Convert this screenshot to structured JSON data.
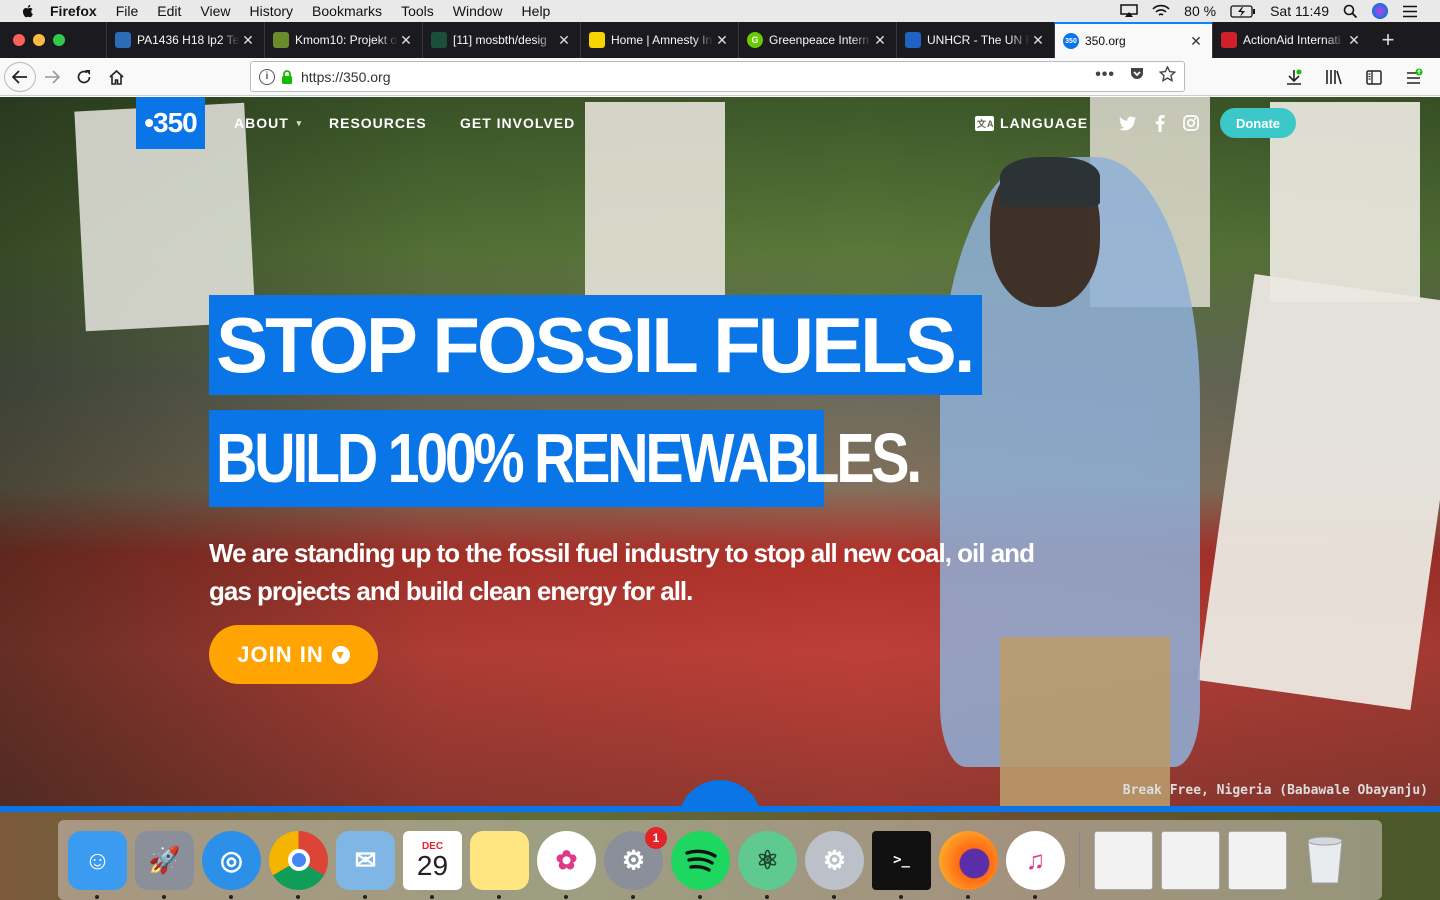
{
  "menubar": {
    "app": "Firefox",
    "menus": [
      "File",
      "Edit",
      "View",
      "History",
      "Bookmarks",
      "Tools",
      "Window",
      "Help"
    ],
    "battery": "80 %",
    "clock": "Sat 11:49"
  },
  "tabs": [
    {
      "title": "PA1436 H18 lp2 Te",
      "color": "#2c6bb5",
      "icon": "globe-icon",
      "glyph": ""
    },
    {
      "title": "Kmom10: Projekt o",
      "color": "#6b8c2a",
      "icon": "star-icon",
      "glyph": ""
    },
    {
      "title": "[11] mosbth/desig",
      "color": "#1b4f3a",
      "icon": "bars-icon",
      "glyph": ""
    },
    {
      "title": "Home | Amnesty In",
      "color": "#f5d400",
      "icon": "candle-icon",
      "glyph": ""
    },
    {
      "title": "Greenpeace Intern",
      "color": "#66cc00",
      "icon": "g-icon",
      "glyph": "G"
    },
    {
      "title": "UNHCR - The UN R",
      "color": "#2062c4",
      "icon": "unhcr-icon",
      "glyph": ""
    },
    {
      "title": "350.org",
      "color": "#0a75e6",
      "icon": "350-icon",
      "glyph": "350",
      "active": true
    },
    {
      "title": "ActionAid Internati",
      "color": "#d0202a",
      "icon": "actionaid-icon",
      "glyph": ""
    }
  ],
  "url": "https://350.org",
  "site": {
    "logo": "•350",
    "nav": [
      {
        "label": "ABOUT",
        "caret": "▾"
      },
      {
        "label": "RESOURCES"
      },
      {
        "label": "GET INVOLVED"
      }
    ],
    "language": "LANGUAGE",
    "donate": "Donate",
    "headline1": "STOP FOSSIL FUELS.",
    "headline2": "BUILD 100% RENEWABLES.",
    "lead": "We are standing up to the fossil fuel industry to stop all new coal, oil and gas projects and build clean energy for all.",
    "join": "JOIN IN",
    "caption": "Break Free, Nigeria (Babawale Obayanju)"
  },
  "dock": {
    "items": [
      {
        "name": "finder-icon",
        "bg": "#3a9bf0",
        "glyph": "☺"
      },
      {
        "name": "launchpad-icon",
        "bg": "#8a8f99",
        "glyph": "🚀"
      },
      {
        "name": "safari-icon",
        "bg": "#2c8fe8",
        "glyph": "◎"
      },
      {
        "name": "chrome-icon",
        "bg": "#ffffff",
        "glyph": ""
      },
      {
        "name": "mail-icon",
        "bg": "#7fb6e6",
        "glyph": "✉"
      },
      {
        "name": "calendar-icon",
        "bg": "#ffffff",
        "glyph": "29",
        "month": "DEC"
      },
      {
        "name": "notes-icon",
        "bg": "#ffe680",
        "glyph": ""
      },
      {
        "name": "photos-icon",
        "bg": "#ffffff",
        "glyph": "✿"
      },
      {
        "name": "system-preferences-icon",
        "bg": "#8a8f99",
        "glyph": "⚙",
        "badge": "1"
      },
      {
        "name": "spotify-icon",
        "bg": "#1ed760",
        "glyph": ""
      },
      {
        "name": "atom-icon",
        "bg": "#5fc990",
        "glyph": "⚛"
      },
      {
        "name": "settings-app-icon",
        "bg": "#bcc0c8",
        "glyph": "⚙"
      },
      {
        "name": "terminal-icon",
        "bg": "#111111",
        "glyph": ">_"
      },
      {
        "name": "firefox-icon",
        "bg": "#ff6a14",
        "glyph": ""
      },
      {
        "name": "itunes-icon",
        "bg": "#ffffff",
        "glyph": "♫"
      }
    ],
    "windows": [
      {
        "name": "spotify-window-thumb"
      },
      {
        "name": "finder-window-thumb"
      },
      {
        "name": "document-window-thumb"
      }
    ],
    "trash": {
      "name": "trash-icon"
    }
  }
}
